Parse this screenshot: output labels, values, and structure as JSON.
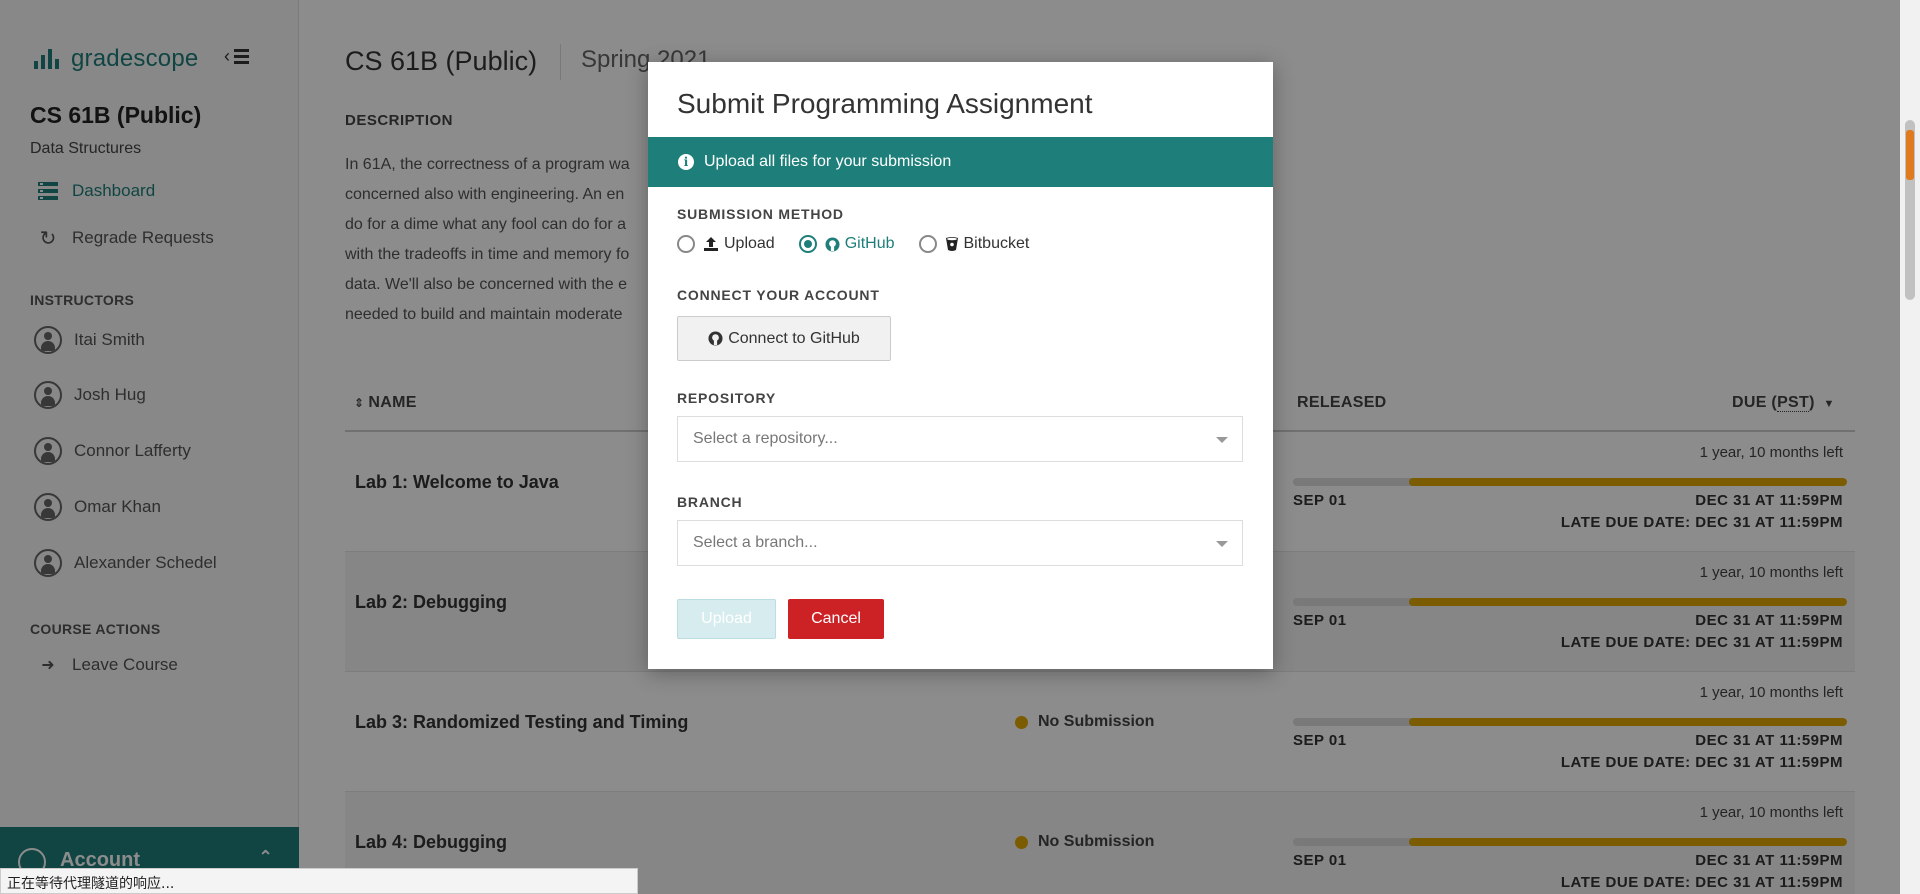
{
  "sidebar": {
    "brand": "gradescope",
    "course_title": "CS 61B (Public)",
    "course_subtitle": "Data Structures",
    "nav": [
      {
        "label": "Dashboard",
        "icon": "dashboard-icon",
        "active": true
      },
      {
        "label": "Regrade Requests",
        "icon": "refresh-icon",
        "active": false
      }
    ],
    "instructors_label": "INSTRUCTORS",
    "instructors": [
      "Itai Smith",
      "Josh Hug",
      "Connor Lafferty",
      "Omar Khan",
      "Alexander Schedel"
    ],
    "course_actions_label": "COURSE ACTIONS",
    "leave_course": "Leave Course",
    "account": "Account",
    "accent": "#1e7f7a"
  },
  "main": {
    "course_title": "CS 61B (Public)",
    "term": "Spring 2021",
    "description_heading": "DESCRIPTION",
    "description_lines": [
      "In 61A, the correctness of a program wa",
      "concerned also with engineering. An en",
      "do for a dime what any fool can do for a",
      "with the tradeoffs in time and memory fo",
      "data. We'll also be concerned with the e",
      "needed to build and maintain moderate"
    ],
    "table": {
      "col_name": "NAME",
      "col_released": "RELEASED",
      "col_due_prefix": "DUE (",
      "col_due_tz": "PST",
      "col_due_suffix": ")",
      "rows": [
        {
          "name": "Lab 1: Welcome to Java",
          "status": "",
          "time_left": "1 year, 10 months left",
          "progress": 0.79,
          "released": "SEP 01",
          "due": "DEC 31 AT 11:59PM",
          "late_due": "LATE DUE DATE: DEC 31 AT 11:59PM"
        },
        {
          "name": "Lab 2: Debugging",
          "status": "",
          "time_left": "1 year, 10 months left",
          "progress": 0.79,
          "released": "SEP 01",
          "due": "DEC 31 AT 11:59PM",
          "late_due": "LATE DUE DATE: DEC 31 AT 11:59PM"
        },
        {
          "name": "Lab 3: Randomized Testing and Timing",
          "status": "No Submission",
          "time_left": "1 year, 10 months left",
          "progress": 0.79,
          "released": "SEP 01",
          "due": "DEC 31 AT 11:59PM",
          "late_due": "LATE DUE DATE: DEC 31 AT 11:59PM"
        },
        {
          "name": "Lab 4: Debugging",
          "status": "No Submission",
          "time_left": "1 year, 10 months left",
          "progress": 0.79,
          "released": "SEP 01",
          "due": "DEC 31 AT 11:59PM",
          "late_due": "LATE DUE DATE: DEC 31 AT 11:59PM"
        }
      ]
    }
  },
  "modal": {
    "title": "Submit Programming Assignment",
    "banner": "Upload all files for your submission",
    "submission_method_label": "SUBMISSION METHOD",
    "methods": [
      {
        "label": "Upload",
        "icon": "upload-icon",
        "selected": false
      },
      {
        "label": "GitHub",
        "icon": "github-icon",
        "selected": true
      },
      {
        "label": "Bitbucket",
        "icon": "bitbucket-icon",
        "selected": false
      }
    ],
    "connect_label": "CONNECT YOUR ACCOUNT",
    "connect_button": "Connect to GitHub",
    "repository_label": "REPOSITORY",
    "repository_placeholder": "Select a repository...",
    "branch_label": "BRANCH",
    "branch_placeholder": "Select a branch...",
    "upload_button": "Upload",
    "cancel_button": "Cancel"
  },
  "browser_status": "正在等待代理隧道的响应..."
}
